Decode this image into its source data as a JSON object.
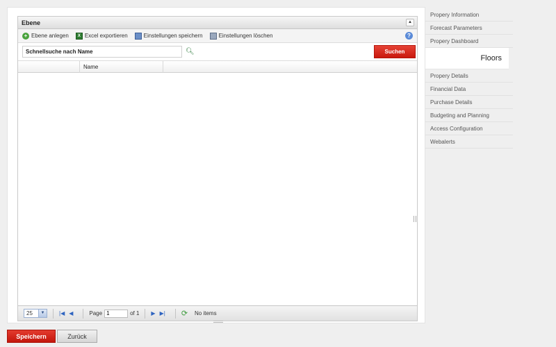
{
  "grid": {
    "title": "Ebene",
    "toolbar": {
      "add_label": "Ebene anlegen",
      "excel_label": "Excel exportieren",
      "save_settings_label": "Einstellungen speichern",
      "delete_settings_label": "Einstellungen löschen"
    },
    "search": {
      "value": "Schnellsuche nach Name",
      "button_label": "Suchen"
    },
    "columns": [
      "",
      "Name"
    ],
    "pager": {
      "page_size": "25",
      "page_label": "Page",
      "page_value": "1",
      "of_label": "of 1",
      "status": "No items"
    }
  },
  "sidebar": {
    "items": [
      {
        "label": "Propery Information"
      },
      {
        "label": "Forecast Parameters"
      },
      {
        "label": "Propery Dashboard"
      },
      {
        "label": "Floors"
      },
      {
        "label": "Propery Details"
      },
      {
        "label": "Financial Data"
      },
      {
        "label": "Purchase Details"
      },
      {
        "label": "Budgeting and Planning"
      },
      {
        "label": "Access Configuration"
      },
      {
        "label": "Webalerts"
      }
    ],
    "active_index": 3
  },
  "footer": {
    "save_label": "Speichern",
    "back_label": "Zurück"
  },
  "colors": {
    "accent_red": "#d42a1e",
    "background": "#efefef"
  }
}
